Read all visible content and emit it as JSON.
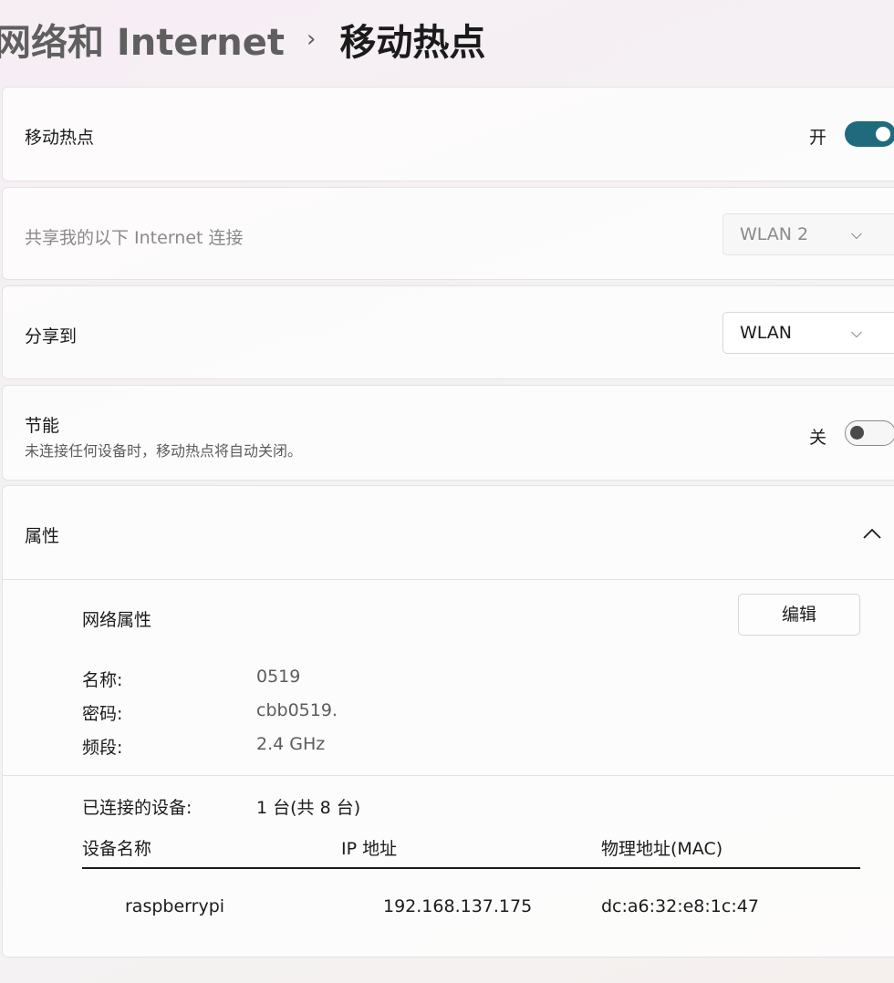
{
  "breadcrumb": {
    "parent": "网络和 Internet",
    "separator": "›",
    "current": "移动热点"
  },
  "hotspot": {
    "label": "移动热点",
    "state": "开"
  },
  "share_from": {
    "label": "共享我的以下 Internet 连接",
    "value": "WLAN 2"
  },
  "share_to": {
    "label": "分享到",
    "value": "WLAN"
  },
  "power_saving": {
    "label": "节能",
    "description": "未连接任何设备时，移动热点将自动关闭。",
    "state": "关"
  },
  "properties": {
    "title": "属性",
    "network_props_label": "网络属性",
    "edit_button": "编辑",
    "fields": [
      {
        "key": "名称:",
        "value": "0519"
      },
      {
        "key": "密码:",
        "value": "cbb0519."
      },
      {
        "key": "频段:",
        "value": "2.4 GHz"
      }
    ],
    "connected_label": "已连接的设备:",
    "connected_value": "1 台(共 8 台)",
    "table": {
      "headers": [
        "设备名称",
        "IP 地址",
        "物理地址(MAC)"
      ],
      "rows": [
        [
          "raspberrypi",
          "192.168.137.175",
          "dc:a6:32:e8:1c:47"
        ]
      ]
    }
  },
  "icons": {
    "chevron": "chevron-down-icon",
    "collapse": "chevron-up-icon"
  }
}
